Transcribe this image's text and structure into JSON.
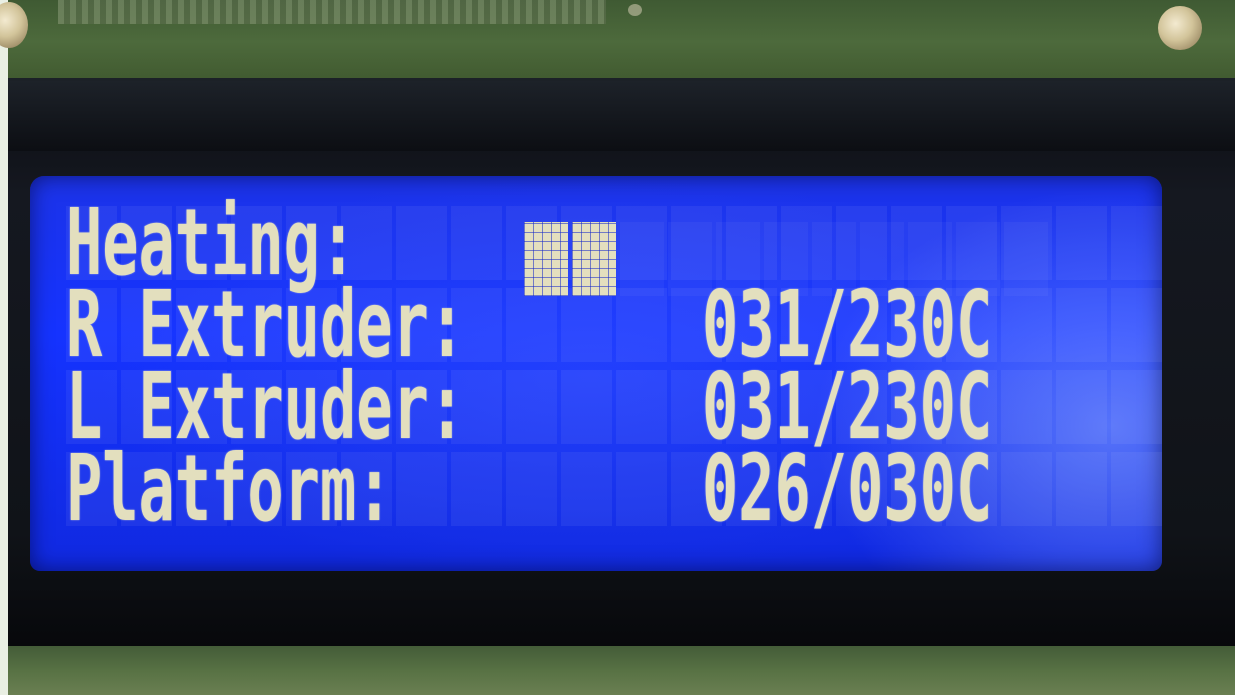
{
  "display": {
    "lines": [
      {
        "label": "Heating:",
        "value": ""
      },
      {
        "label": "R Extruder:",
        "value": "031/230C"
      },
      {
        "label": "L Extruder:",
        "value": "031/230C"
      },
      {
        "label": "Platform:",
        "value": "026/030C"
      }
    ],
    "heating_progress": {
      "filled_blocks": 2,
      "total_blocks": 11
    }
  },
  "colors": {
    "lcd_background": "#1533ff",
    "character": "#e3dfbe",
    "pcb": "#40592f",
    "bezel": "#101318"
  }
}
